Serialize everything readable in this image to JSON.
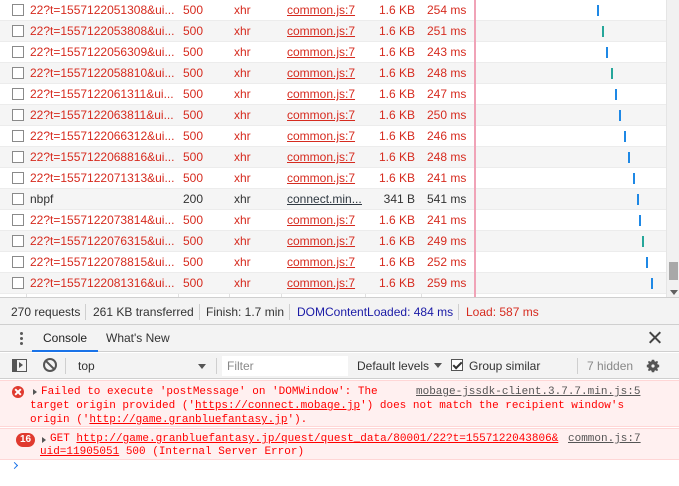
{
  "network": {
    "rows": [
      {
        "name": "22?t=1557122051308&ui...",
        "status": "500",
        "type": "xhr",
        "initiator": "common.js:7",
        "size": "1.6 KB",
        "time": "254 ms",
        "error": true,
        "wf_color": "#1e88e5"
      },
      {
        "name": "22?t=1557122053808&ui...",
        "status": "500",
        "type": "xhr",
        "initiator": "common.js:7",
        "size": "1.6 KB",
        "time": "251 ms",
        "error": true,
        "wf_color": "#26a69a"
      },
      {
        "name": "22?t=1557122056309&ui...",
        "status": "500",
        "type": "xhr",
        "initiator": "common.js:7",
        "size": "1.6 KB",
        "time": "243 ms",
        "error": true,
        "wf_color": "#1e88e5"
      },
      {
        "name": "22?t=1557122058810&ui...",
        "status": "500",
        "type": "xhr",
        "initiator": "common.js:7",
        "size": "1.6 KB",
        "time": "248 ms",
        "error": true,
        "wf_color": "#26a69a"
      },
      {
        "name": "22?t=1557122061311&ui...",
        "status": "500",
        "type": "xhr",
        "initiator": "common.js:7",
        "size": "1.6 KB",
        "time": "247 ms",
        "error": true,
        "wf_color": "#1e88e5"
      },
      {
        "name": "22?t=1557122063811&ui...",
        "status": "500",
        "type": "xhr",
        "initiator": "common.js:7",
        "size": "1.6 KB",
        "time": "250 ms",
        "error": true,
        "wf_color": "#1e88e5"
      },
      {
        "name": "22?t=1557122066312&ui...",
        "status": "500",
        "type": "xhr",
        "initiator": "common.js:7",
        "size": "1.6 KB",
        "time": "246 ms",
        "error": true,
        "wf_color": "#1e88e5"
      },
      {
        "name": "22?t=1557122068816&ui...",
        "status": "500",
        "type": "xhr",
        "initiator": "common.js:7",
        "size": "1.6 KB",
        "time": "248 ms",
        "error": true,
        "wf_color": "#1e88e5"
      },
      {
        "name": "22?t=1557122071313&ui...",
        "status": "500",
        "type": "xhr",
        "initiator": "common.js:7",
        "size": "1.6 KB",
        "time": "241 ms",
        "error": true,
        "wf_color": "#1e88e5"
      },
      {
        "name": "nbpf",
        "status": "200",
        "type": "xhr",
        "initiator": "connect.min....",
        "size": "341 B",
        "time": "541 ms",
        "error": false,
        "wf_color": "#1e88e5"
      },
      {
        "name": "22?t=1557122073814&ui...",
        "status": "500",
        "type": "xhr",
        "initiator": "common.js:7",
        "size": "1.6 KB",
        "time": "241 ms",
        "error": true,
        "wf_color": "#1e88e5"
      },
      {
        "name": "22?t=1557122076315&ui...",
        "status": "500",
        "type": "xhr",
        "initiator": "common.js:7",
        "size": "1.6 KB",
        "time": "249 ms",
        "error": true,
        "wf_color": "#26a69a"
      },
      {
        "name": "22?t=1557122078815&ui...",
        "status": "500",
        "type": "xhr",
        "initiator": "common.js:7",
        "size": "1.6 KB",
        "time": "252 ms",
        "error": true,
        "wf_color": "#1e88e5"
      },
      {
        "name": "22?t=1557122081316&ui...",
        "status": "500",
        "type": "xhr",
        "initiator": "common.js:7",
        "size": "1.6 KB",
        "time": "259 ms",
        "error": true,
        "wf_color": "#1e88e5"
      }
    ]
  },
  "summary": {
    "requests": "270 requests",
    "transferred": "261 KB transferred",
    "finish": "Finish: 1.7 min",
    "dcl": "DOMContentLoaded: 484 ms",
    "load": "Load: 587 ms",
    "dcl_color": "#1a1aa6",
    "load_color": "#d62b1f"
  },
  "drawer": {
    "tabs": [
      {
        "label": "Console",
        "active": true
      },
      {
        "label": "What's New",
        "active": false
      }
    ]
  },
  "console_toolbar": {
    "context": "top",
    "filter_placeholder": "Filter",
    "levels": "Default levels",
    "group_similar": "Group similar",
    "group_similar_checked": true,
    "hidden": "7 hidden"
  },
  "messages": [
    {
      "kind": "error",
      "lines": [
        "Failed to execute 'postMessage' on 'DOMWindow': The",
        "target origin provided ('https://connect.mobage.jp') does not match the recipient window's",
        "origin ('http://game.granbluefantasy.jp')."
      ],
      "source": "mobage-jssdk-client.3.7.7.min.js:5"
    },
    {
      "kind": "error-group",
      "count": "16",
      "method": "GET",
      "url_line1": "http://game.granbluefantasy.jp/quest/quest_data/80001/22?t=1557122043806&",
      "url_line2": "uid=11905051",
      "status_text": " 500 (Internal Server Error)",
      "source": "common.js:7"
    }
  ]
}
